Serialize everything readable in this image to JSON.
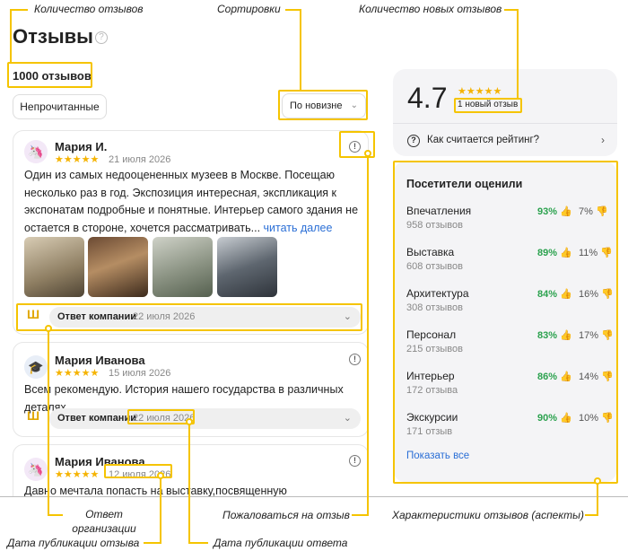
{
  "annotations": {
    "reviews_count": "Количество отзывов",
    "sorting": "Сортировки",
    "new_reviews_count": "Количество новых отзывов",
    "org_reply": "Ответ организации",
    "complain": "Пожаловаться на отзыв",
    "aspects": "Характеристики отзывов (аспекты)",
    "review_date": "Дата публикации отзыва",
    "reply_date": "Дата публикации ответа"
  },
  "header": {
    "title": "Отзывы",
    "help_icon": "question-circle-icon",
    "count": "1000 отзывов"
  },
  "filters": {
    "unread": "Непрочитанные",
    "sort_value": "По новизне"
  },
  "reviews": [
    {
      "name": "Мария И.",
      "stars": "★★★★★",
      "date": "21 июля 2026",
      "avatar": "unicorn",
      "text": "Один из самых недооцененных музеев в Москве. Посещаю несколько раз в год. Экспозиция интересная, экспликация к экспонатам подробные и понятные. Интерьер самого здания не остается в стороне, хочется рассматривать...",
      "more": "читать далее",
      "reply_label": "Ответ компании",
      "reply_date": "22 июля 2026"
    },
    {
      "name": "Мария Иванова",
      "stars": "★★★★★",
      "date": "15 июля 2026",
      "avatar": "graduation-cap",
      "text": "Всем рекомендую. История нашего государства в различных деталях",
      "reply_label": "Ответ компании",
      "reply_date": "22 июля 2026"
    },
    {
      "name": "Мария Иванова",
      "stars": "★★★★★",
      "date": "12 июля 2026",
      "avatar": "unicorn",
      "text": "Давно мечтала попасть на выставку,посвященную"
    }
  ],
  "rating": {
    "value": "4.7",
    "stars": "★★★★★",
    "new_count": "1 новый отзыв",
    "how_label": "Как считается рейтинг?"
  },
  "aspects": {
    "title": "Посетители оценили",
    "items": [
      {
        "name": "Впечатления",
        "count": "958 отзывов",
        "pos": "93%",
        "neg": "7%"
      },
      {
        "name": "Выставка",
        "count": "608 отзывов",
        "pos": "89%",
        "neg": "11%"
      },
      {
        "name": "Архитектура",
        "count": "308 отзывов",
        "pos": "84%",
        "neg": "16%"
      },
      {
        "name": "Персонал",
        "count": "215 отзывов",
        "pos": "83%",
        "neg": "17%"
      },
      {
        "name": "Интерьер",
        "count": "172 отзыва",
        "pos": "86%",
        "neg": "14%"
      },
      {
        "name": "Экскурсии",
        "count": "171 отзыв",
        "pos": "90%",
        "neg": "10%"
      }
    ],
    "show_all": "Показать все"
  },
  "colors": {
    "highlight": "#f5c400",
    "star": "#f5b301",
    "positive": "#2ca24f",
    "link": "#2b6fd6"
  }
}
